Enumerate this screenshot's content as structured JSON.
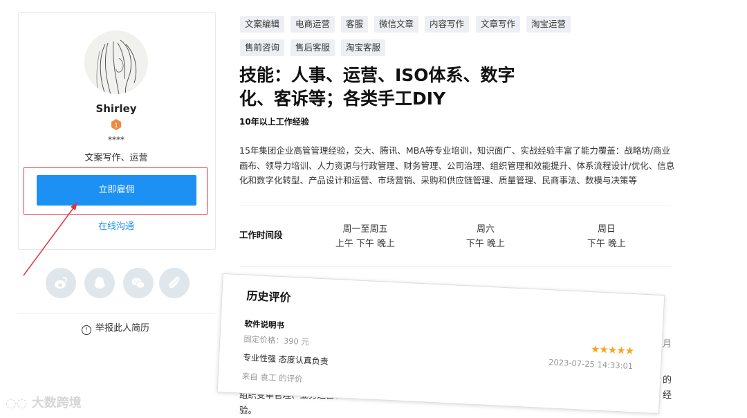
{
  "profile": {
    "name": "Shirley",
    "rating_masked": "****",
    "role": "文案写作、运营",
    "hire_label": "立即雇佣",
    "chat_label": "在线沟通",
    "report_label": "举报此人简历"
  },
  "tags_row1": [
    "文案编辑",
    "电商运营",
    "客服",
    "微信文章",
    "内容写作",
    "文章写作",
    "淘宝运营"
  ],
  "tags_row2": [
    "售前咨询",
    "售后客服",
    "淘宝客服"
  ],
  "headline": "技能：人事、运营、ISO体系、数字化、客诉等；各类手工DIY",
  "experience": "10年以上工作经验",
  "description": "15年集团企业高管管理经验，交大、腾讯、MBA等专业培训，知识面广、实战经验丰富了能力覆盖：战略坊/商业画布、领导力培训、人力资源与行政管理、财务管理、公司治理、组织管理和效能提升、体系流程设计/优化、信息化和数字化转型、产品设计和运营、市场营销、采购和供应链管理、质量管理、民商事法、数模与决策等",
  "work_time": {
    "label": "工作时间段",
    "columns": [
      {
        "days": "周一至周五",
        "slots": "上午 下午 晚上"
      },
      {
        "days": "周六",
        "slots": "下午 晚上"
      },
      {
        "days": "周日",
        "slots": "下午 晚上"
      }
    ]
  },
  "review": {
    "section_title": "历史评价",
    "product": "软件说明书",
    "price": "固定价格：390 元",
    "comment": "专业性强 态度认真负责",
    "from": "来自 袁工 的评价",
    "stars": "★★★★★",
    "time": "2023-07-25 14:33:01"
  },
  "bottom_partial": {
    "line1": "组织变革管理、业务运营、",
    "line2": "验。",
    "right_fragment_1": "月",
    "right_fragment_2": "的",
    "right_fragment_3": "经"
  },
  "watermark": "大数跨境",
  "colors": {
    "primary": "#1c90f3",
    "highlight_red": "#e0343b",
    "star": "#f5a623",
    "badge": "#f0883e"
  }
}
